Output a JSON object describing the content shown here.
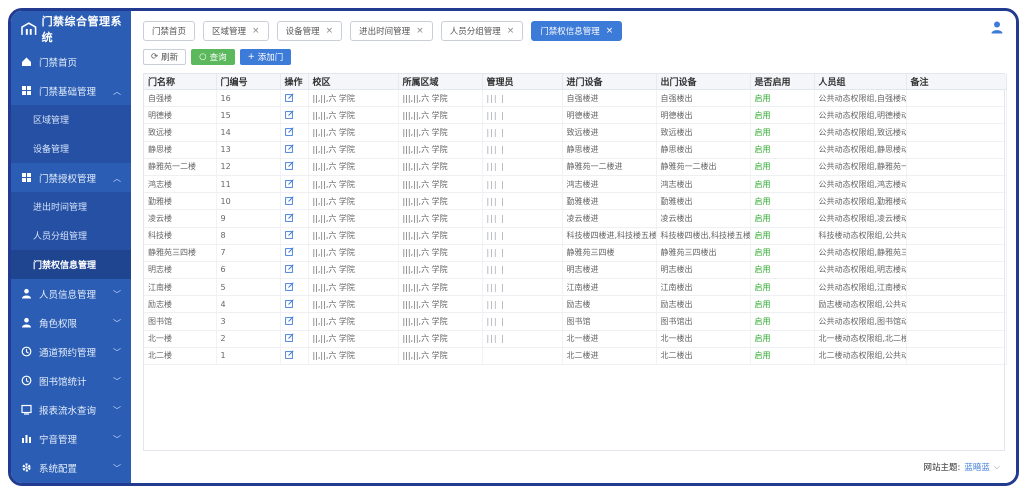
{
  "app": {
    "title": "门禁综合管理系统"
  },
  "sidebar": {
    "items": [
      {
        "label": "门禁首页",
        "icon": "home-icon"
      },
      {
        "label": "门禁基础管理",
        "icon": "grid-icon",
        "expanded": true,
        "children": [
          {
            "label": "区域管理"
          },
          {
            "label": "设备管理"
          }
        ]
      },
      {
        "label": "门禁授权管理",
        "icon": "grid-icon",
        "expanded": true,
        "children": [
          {
            "label": "进出时间管理"
          },
          {
            "label": "人员分组管理"
          },
          {
            "label": "门禁权信息管理",
            "active": true
          }
        ]
      },
      {
        "label": "人员信息管理",
        "icon": "person-icon"
      },
      {
        "label": "角色权限",
        "icon": "person-icon"
      },
      {
        "label": "通道预约管理",
        "icon": "clock-icon"
      },
      {
        "label": "图书馆统计",
        "icon": "clock-icon"
      },
      {
        "label": "报表流水查询",
        "icon": "report-icon"
      },
      {
        "label": "宁音管理",
        "icon": "chart-icon"
      },
      {
        "label": "系统配置",
        "icon": "gear-icon"
      }
    ]
  },
  "tabs": [
    {
      "label": "门禁首页",
      "closable": false
    },
    {
      "label": "区域管理",
      "closable": true
    },
    {
      "label": "设备管理",
      "closable": true
    },
    {
      "label": "进出时间管理",
      "closable": true
    },
    {
      "label": "人员分组管理",
      "closable": true
    },
    {
      "label": "门禁权信息管理",
      "closable": true,
      "active": true
    }
  ],
  "toolbar": {
    "refresh_label": "刷新",
    "query_label": "查询",
    "add_label": "添加门"
  },
  "table": {
    "columns": [
      "门名称",
      "门编号",
      "操作",
      "校区",
      "所属区域",
      "管理员",
      "进门设备",
      "出门设备",
      "是否启用",
      "人员组",
      "备注"
    ],
    "rows": [
      [
        "自强楼",
        "16",
        "",
        "||,||,六 学院",
        "|||,||,六 学院",
        "||| |",
        "自强楼进",
        "自强楼出",
        "启用",
        "公共动态权限组,自强楼动",
        ""
      ],
      [
        "明德楼",
        "15",
        "",
        "||,||,六 学院",
        "|||,||,六 学院",
        "||| |",
        "明德楼进",
        "明德楼出",
        "启用",
        "公共动态权限组,明德楼动",
        ""
      ],
      [
        "致远楼",
        "14",
        "",
        "||,||,六 学院",
        "|||,||,六 学院",
        "||| |",
        "致远楼进",
        "致远楼出",
        "启用",
        "公共动态权限组,致远楼动",
        ""
      ],
      [
        "静思楼",
        "13",
        "",
        "||,||,六 学院",
        "|||,||,六 学院",
        "||| |",
        "静思楼进",
        "静思楼出",
        "启用",
        "公共动态权限组,静思楼动",
        ""
      ],
      [
        "静雅苑一二楼",
        "12",
        "",
        "||,||,六 学院",
        "|||,||,六 学院",
        "||| |",
        "静雅苑一二楼进",
        "静雅苑一二楼出",
        "启用",
        "公共动态权限组,静雅苑一",
        ""
      ],
      [
        "鸿志楼",
        "11",
        "",
        "||,||,六 学院",
        "|||,||,六 学院",
        "||| |",
        "鸿志楼进",
        "鸿志楼出",
        "启用",
        "公共动态权限组,鸿志楼动",
        ""
      ],
      [
        "勤雅楼",
        "10",
        "",
        "||,||,六 学院",
        "|||,||,六 学院",
        "||| |",
        "勤雅楼进",
        "勤雅楼出",
        "启用",
        "公共动态权限组,勤雅楼动",
        ""
      ],
      [
        "凌云楼",
        "9",
        "",
        "||,||,六 学院",
        "|||,||,六 学院",
        "||| |",
        "凌云楼进",
        "凌云楼出",
        "启用",
        "公共动态权限组,凌云楼动",
        ""
      ],
      [
        "科技楼",
        "8",
        "",
        "||,||,六 学院",
        "|||,||,六 学院",
        "||| |",
        "科技楼四楼进,科技楼五楼",
        "科技楼四楼出,科技楼五楼",
        "启用",
        "科技楼动态权限组,公共动",
        ""
      ],
      [
        "静雅苑三四楼",
        "7",
        "",
        "||,||,六 学院",
        "|||,||,六 学院",
        "||| |",
        "静雅苑三四楼",
        "静雅苑三四楼出",
        "启用",
        "公共动态权限组,静雅苑三",
        ""
      ],
      [
        "明志楼",
        "6",
        "",
        "||,||,六 学院",
        "|||,||,六 学院",
        "||| |",
        "明志楼进",
        "明志楼出",
        "启用",
        "公共动态权限组,明志楼动",
        ""
      ],
      [
        "江南楼",
        "5",
        "",
        "||,||,六 学院",
        "|||,||,六 学院",
        "||| |",
        "江南楼进",
        "江南楼出",
        "启用",
        "公共动态权限组,江南楼动",
        ""
      ],
      [
        "励志楼",
        "4",
        "",
        "||,||,六 学院",
        "|||,||,六 学院",
        "||| |",
        "励志楼",
        "励志楼出",
        "启用",
        "励志楼动态权限组,公共动",
        ""
      ],
      [
        "图书馆",
        "3",
        "",
        "||,||,六 学院",
        "|||,||,六 学院",
        "||| |",
        "图书馆",
        "图书馆出",
        "启用",
        "公共动态权限组,图书馆动",
        ""
      ],
      [
        "北一楼",
        "2",
        "",
        "||,||,六 学院",
        "|||,||,六 学院",
        "||| |",
        "北一楼进",
        "北一楼出",
        "启用",
        "北一楼动态权限组,北二楼",
        ""
      ],
      [
        "北二楼",
        "1",
        "",
        "||,||,六 学院",
        "|||,||,六 学院",
        "",
        "北二楼进",
        "北二楼出",
        "启用",
        "北二楼动态权限组,公共动",
        ""
      ]
    ]
  },
  "footer": {
    "theme_label": "网站主题:",
    "theme_value": "蓝暗蓝"
  },
  "colors": {
    "sidebar": "#2a5db3",
    "accent": "#3d7bd9",
    "success": "#5cb85c",
    "status_on": "#2faa2f"
  }
}
